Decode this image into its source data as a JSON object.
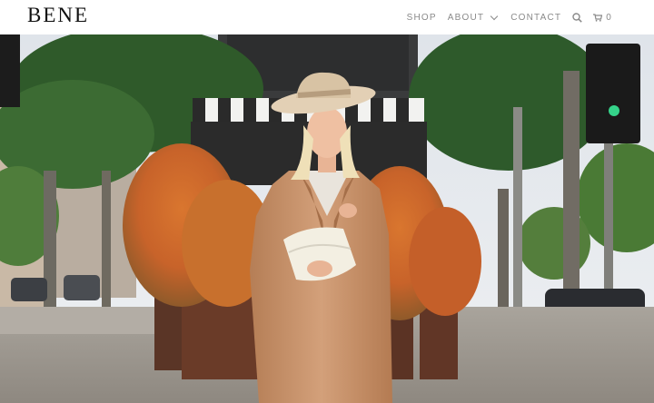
{
  "brand": {
    "logo_text": "BENE"
  },
  "nav": {
    "shop": "SHOP",
    "about": "ABOUT",
    "contact": "CONTACT",
    "cart_count": "0"
  },
  "icons": {
    "search": "search-icon",
    "cart": "cart-icon",
    "about_dropdown": "chevron-down-icon"
  },
  "colors": {
    "nav_text": "#8a8a8a",
    "logo": "#111111",
    "coat": "#c9936a"
  }
}
